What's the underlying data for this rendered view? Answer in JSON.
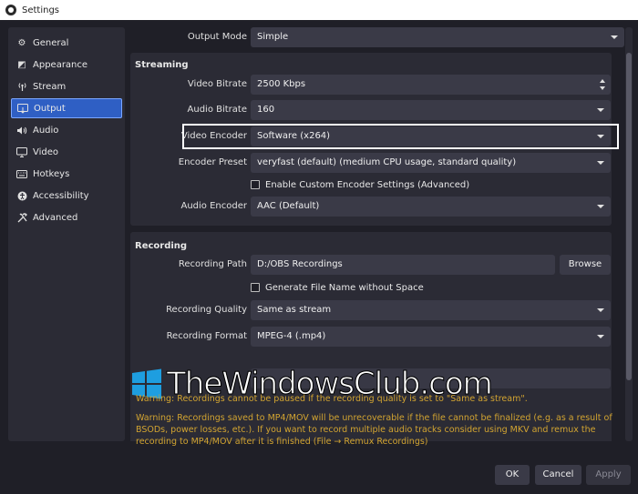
{
  "window": {
    "title": "Settings"
  },
  "sidebar": {
    "items": [
      {
        "label": "General",
        "icon": "gear-icon",
        "glyph": "⚙"
      },
      {
        "label": "Appearance",
        "icon": "appearance-icon",
        "glyph": "◩"
      },
      {
        "label": "Stream",
        "icon": "antenna-icon",
        "glyph": "📶"
      },
      {
        "label": "Output",
        "icon": "output-icon",
        "glyph": "▭"
      },
      {
        "label": "Audio",
        "icon": "speaker-icon",
        "glyph": "🔊"
      },
      {
        "label": "Video",
        "icon": "monitor-icon",
        "glyph": "▣"
      },
      {
        "label": "Hotkeys",
        "icon": "keyboard-icon",
        "glyph": "⌨"
      },
      {
        "label": "Accessibility",
        "icon": "accessibility-icon",
        "glyph": "♿"
      },
      {
        "label": "Advanced",
        "icon": "tools-icon",
        "glyph": "✂"
      }
    ],
    "active": "Output"
  },
  "output": {
    "mode_label": "Output Mode",
    "mode_value": "Simple",
    "streaming": {
      "title": "Streaming",
      "video_bitrate_label": "Video Bitrate",
      "video_bitrate_value": "2500 Kbps",
      "audio_bitrate_label": "Audio Bitrate",
      "audio_bitrate_value": "160",
      "video_encoder_label": "Video Encoder",
      "video_encoder_value": "Software (x264)",
      "encoder_preset_label": "Encoder Preset",
      "encoder_preset_value": "veryfast (default) (medium CPU usage, standard quality)",
      "custom_encoder_label": "Enable Custom Encoder Settings (Advanced)",
      "audio_encoder_label": "Audio Encoder",
      "audio_encoder_value": "AAC (Default)"
    },
    "recording": {
      "title": "Recording",
      "path_label": "Recording Path",
      "path_value": "D:/OBS Recordings",
      "browse_label": "Browse",
      "no_space_label": "Generate File Name without Space",
      "quality_label": "Recording Quality",
      "quality_value": "Same as stream",
      "format_label": "Recording Format",
      "format_value": "MPEG-4 (.mp4)"
    },
    "warnings": [
      "Warning: Recordings cannot be paused if the recording quality is set to \"Same as stream\".",
      "Warning: Recordings saved to MP4/MOV will be unrecoverable if the file cannot be finalized (e.g. as a result of BSODs, power losses, etc.). If you want to record multiple audio tracks consider using MKV and remux the recording to MP4/MOV after it is finished (File → Remux Recordings)"
    ]
  },
  "watermark": {
    "text": "TheWindowsClub.com"
  },
  "footer": {
    "ok_label": "OK",
    "cancel_label": "Cancel",
    "apply_label": "Apply"
  },
  "colors": {
    "accent": "#2f5fc4",
    "warning": "#d2a431",
    "panel": "#2b2b35",
    "background": "#1f1f27"
  }
}
